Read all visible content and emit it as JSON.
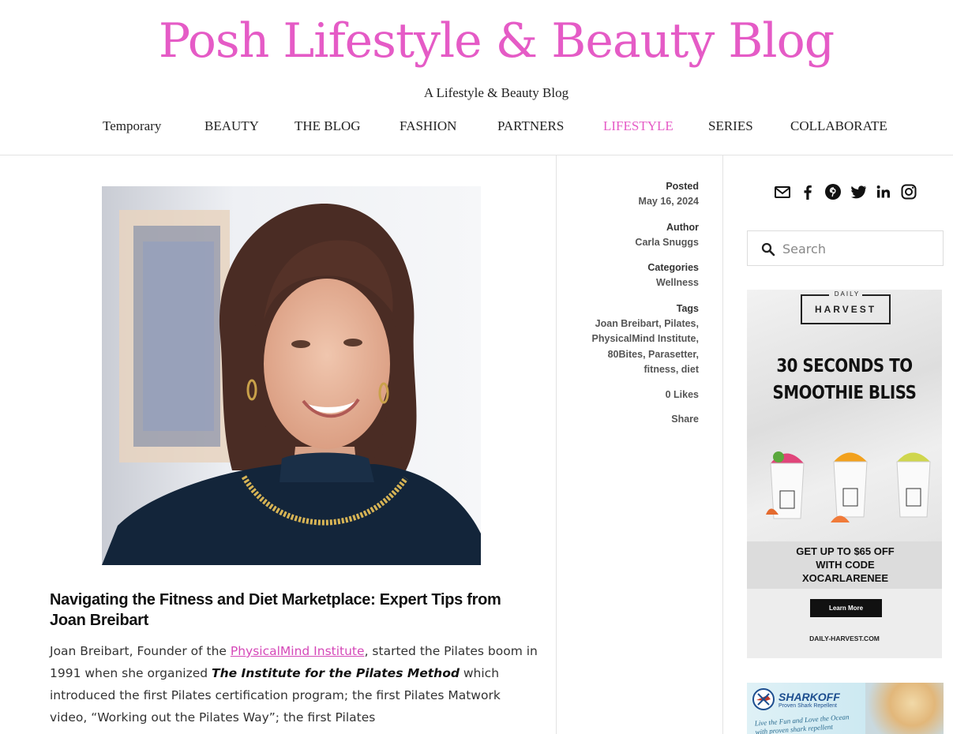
{
  "site": {
    "title": "Posh Lifestyle & Beauty Blog",
    "tagline": "A Lifestyle & Beauty Blog"
  },
  "nav": {
    "items": [
      {
        "label": "Temporary"
      },
      {
        "label": "BEAUTY"
      },
      {
        "label": "THE BLOG"
      },
      {
        "label": "FASHION"
      },
      {
        "label": "PARTNERS"
      },
      {
        "label": "LIFESTYLE",
        "active": true
      },
      {
        "label": "SERIES"
      },
      {
        "label": "COLLABORATE"
      }
    ],
    "active_color": "#e55bc6"
  },
  "post": {
    "title": "Navigating the Fitness and Diet Marketplace: Expert Tips from Joan Breibart",
    "body": {
      "t1": "Joan Breibart, Founder of the ",
      "link": "PhysicalMind Institute",
      "t2": ", started the Pilates boom in 1991 when she organized ",
      "em": "The Institute for the Pilates Method",
      "t3": " which introduced the first Pilates certification program; the first Pilates Matwork video, “Working out the Pilates Way”; the first Pilates"
    }
  },
  "meta": {
    "posted_label": "Posted",
    "posted_value": "May 16, 2024",
    "author_label": "Author",
    "author_value": "Carla Snuggs",
    "categories_label": "Categories",
    "categories_value": "Wellness",
    "tags_label": "Tags",
    "tags": [
      "Joan Breibart",
      "Pilates",
      "PhysicalMind Institute",
      "80Bites",
      "Parasetter",
      "fitness",
      "diet"
    ],
    "likes": "0 Likes",
    "share": "Share"
  },
  "sidebar": {
    "social_icons": [
      "email-icon",
      "facebook-icon",
      "pinterest-icon",
      "twitter-icon",
      "linkedin-icon",
      "instagram-icon"
    ],
    "search_placeholder": "Search"
  },
  "ads": {
    "daily_harvest": {
      "logo_top": "DAILY",
      "logo_bottom": "HARVEST",
      "headline_1": "30 SECONDS TO",
      "headline_2": "SMOOTHIE BLISS",
      "offer_1": "GET UP TO $65 OFF",
      "offer_2": "WITH CODE",
      "offer_3": "XOCARLARENEE",
      "button": "Learn More",
      "url": "DAILY-HARVEST.COM"
    },
    "shark_off": {
      "brand": "SHARKOFF",
      "sub": "Proven Shark Repellent",
      "tagline": "Live the Fun and Love the Ocean with proven shark repellent"
    }
  }
}
